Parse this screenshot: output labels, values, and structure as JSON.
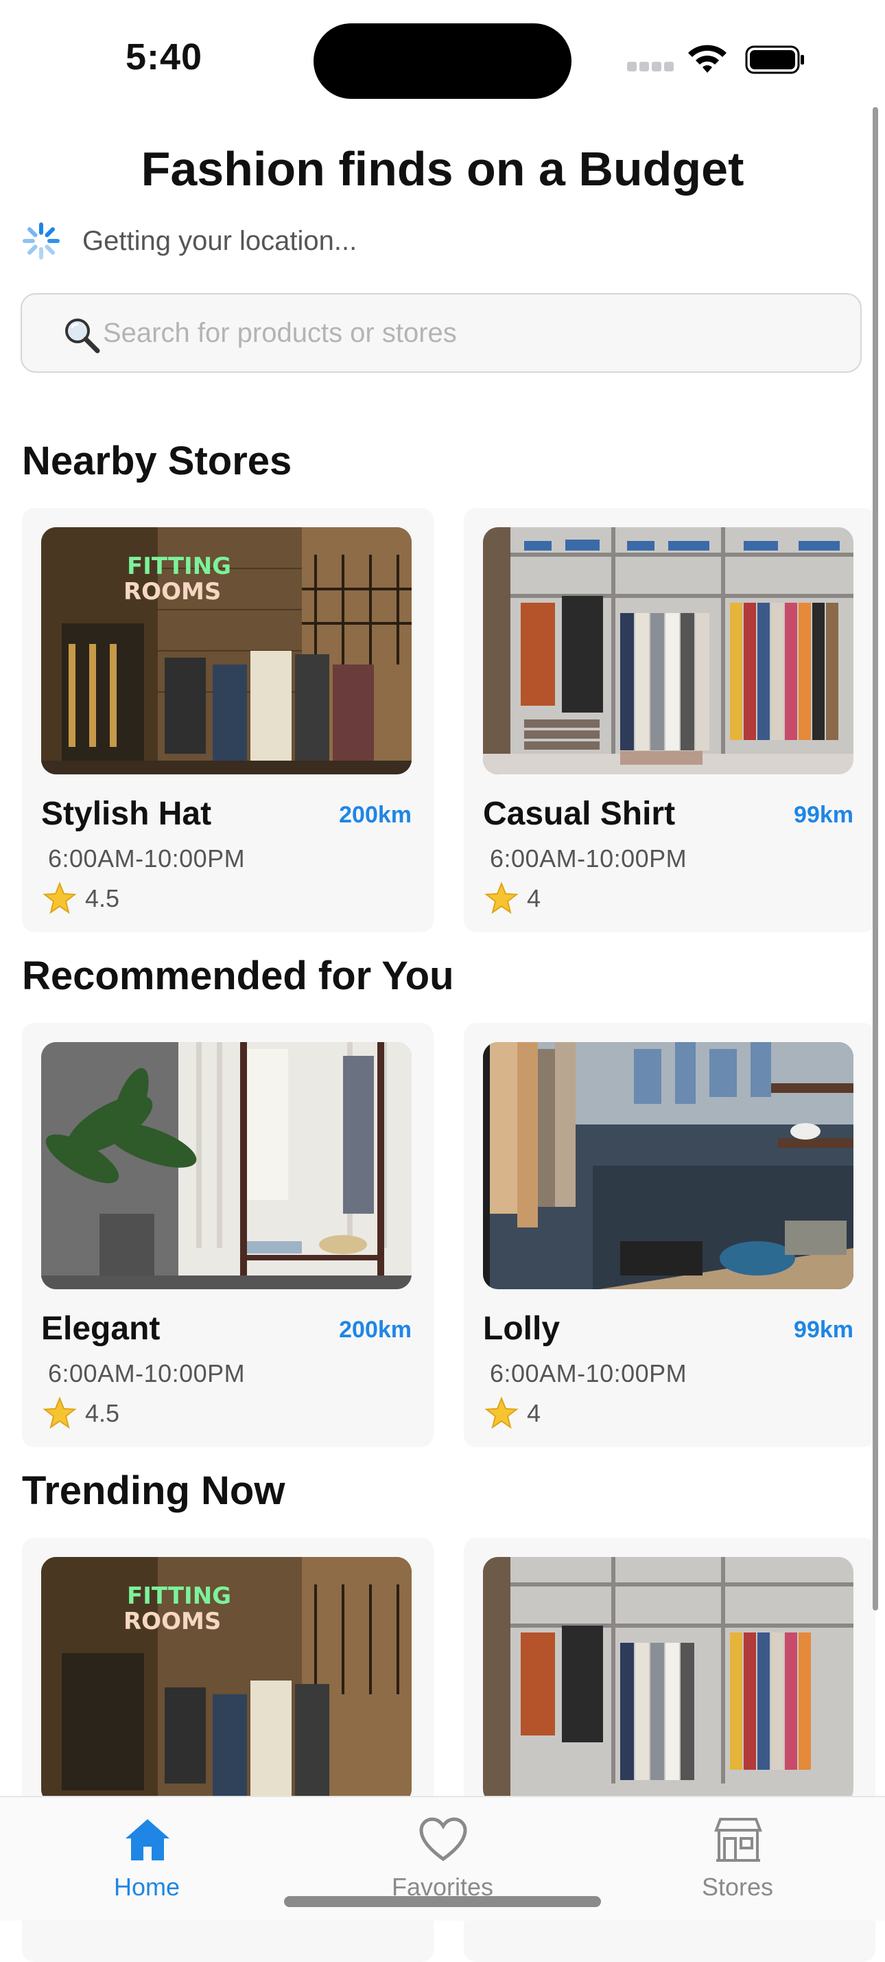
{
  "status_bar": {
    "time": "5:40"
  },
  "header": {
    "title": "Fashion finds on a Budget",
    "location_status": "Getting your location..."
  },
  "search": {
    "placeholder": "Search for products or stores"
  },
  "sections": [
    {
      "title": "Nearby Stores",
      "cards": [
        {
          "name": "Stylish Hat",
          "distance": "200km",
          "hours": "6:00AM-10:00PM",
          "rating": "4.5",
          "image": "fitting-rooms-store-photo"
        },
        {
          "name": "Casual Shirt",
          "distance": "99km",
          "hours": "6:00AM-10:00PM",
          "rating": "4",
          "image": "clothing-racks-photo"
        }
      ]
    },
    {
      "title": "Recommended for You",
      "cards": [
        {
          "name": "Elegant",
          "distance": "200km",
          "hours": "6:00AM-10:00PM",
          "rating": "4.5",
          "image": "plant-and-clothes-rack-photo"
        },
        {
          "name": "Lolly",
          "distance": "99km",
          "hours": "6:00AM-10:00PM",
          "rating": "4",
          "image": "boutique-interior-photo"
        }
      ]
    },
    {
      "title": "Trending Now",
      "cards": [
        {
          "name": "",
          "distance": "",
          "hours": "",
          "rating": "",
          "image": "fitting-rooms-store-photo"
        },
        {
          "name": "",
          "distance": "",
          "hours": "",
          "rating": "",
          "image": "clothing-racks-photo"
        }
      ]
    }
  ],
  "tab_bar": {
    "items": [
      {
        "label": "Home",
        "icon": "home-icon",
        "active": true
      },
      {
        "label": "Favorites",
        "icon": "heart-icon",
        "active": false
      },
      {
        "label": "Stores",
        "icon": "store-icon",
        "active": false
      }
    ]
  },
  "colors": {
    "accent": "#1f86e5",
    "card_bg": "#f7f7f7",
    "muted_text": "#555555"
  }
}
